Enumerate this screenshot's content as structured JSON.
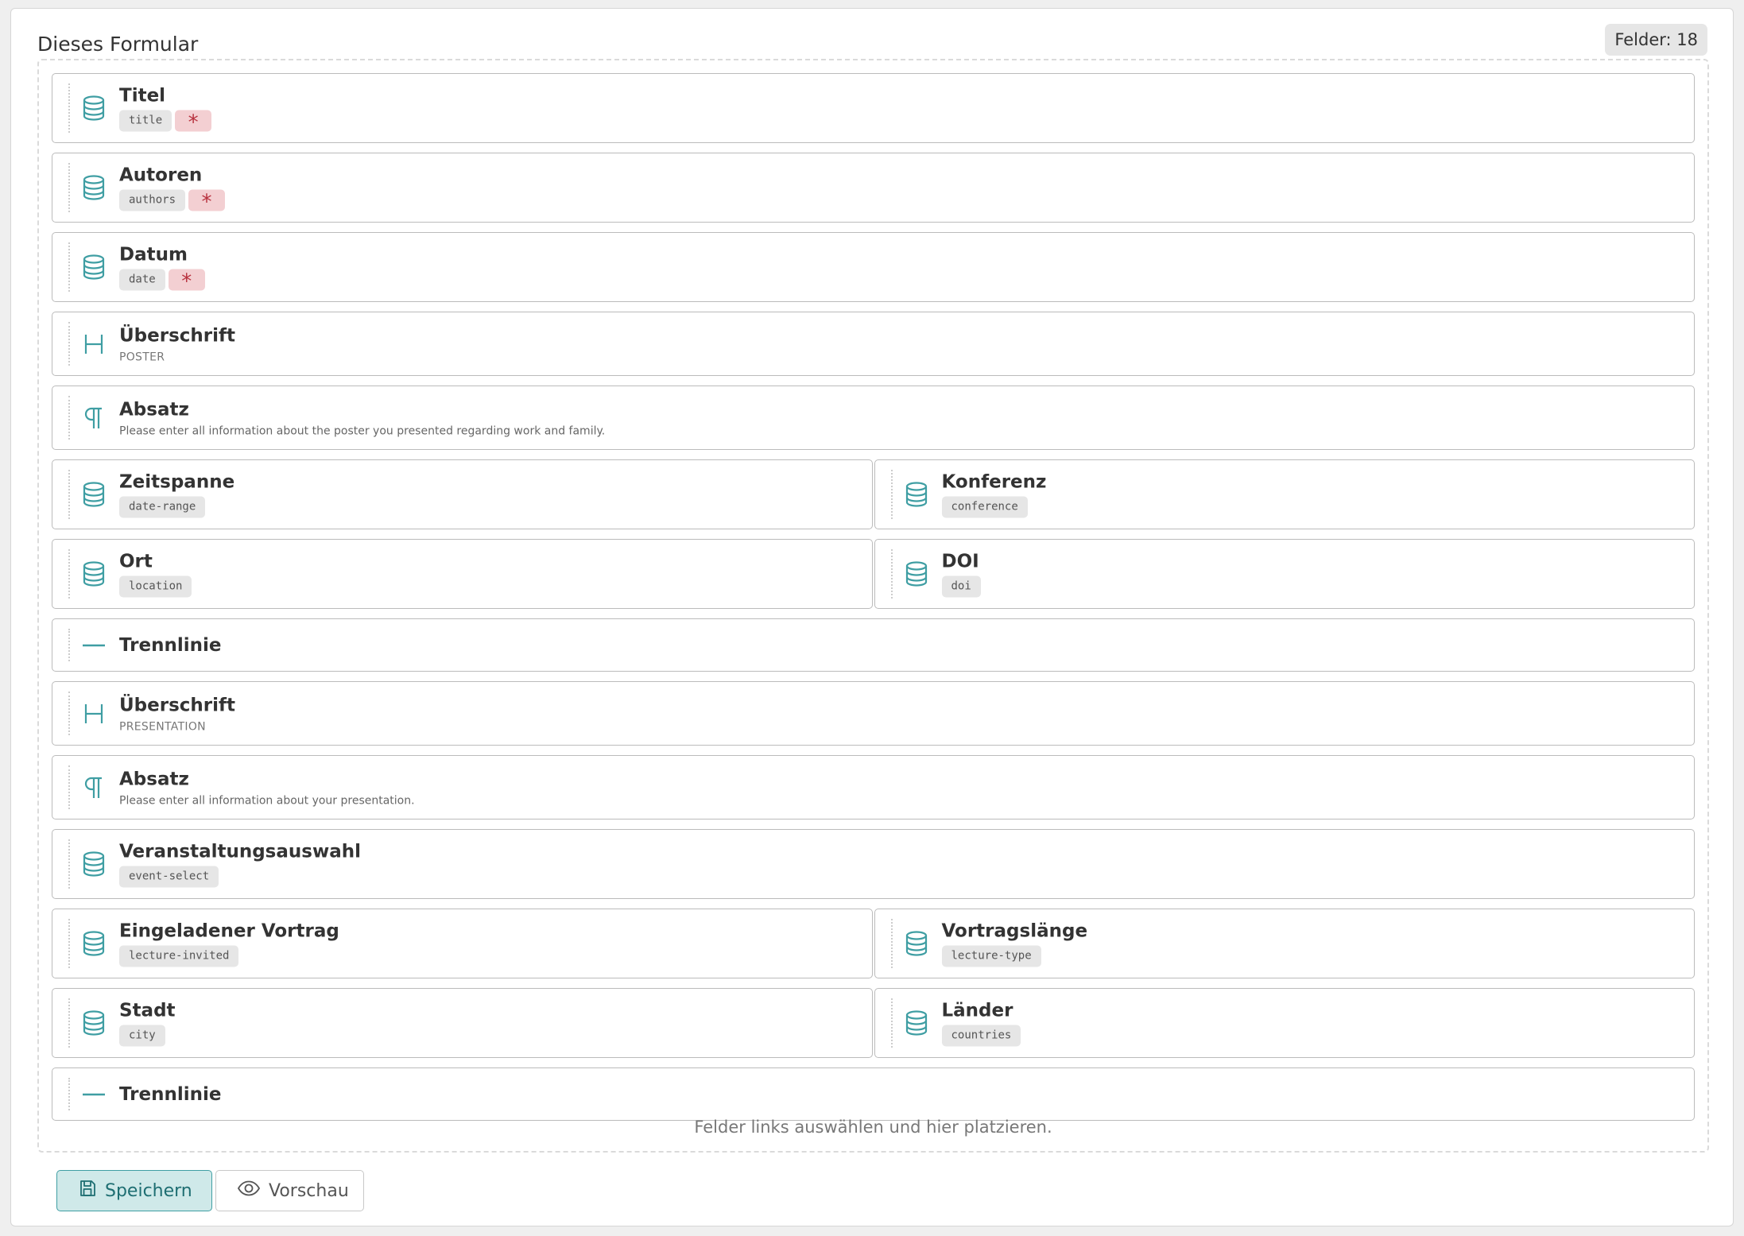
{
  "panel": {
    "title": "Dieses Formular",
    "count_label": "Felder: 18"
  },
  "colors": {
    "accent": "#3f9ea3",
    "required_bg": "#f3cfd2",
    "required_fg": "#b8323f"
  },
  "rows": [
    [
      {
        "type": "data",
        "icon": "database-icon",
        "label": "Titel",
        "key": "title",
        "required": true
      }
    ],
    [
      {
        "type": "data",
        "icon": "database-icon",
        "label": "Autoren",
        "key": "authors",
        "required": true
      }
    ],
    [
      {
        "type": "data",
        "icon": "database-icon",
        "label": "Datum",
        "key": "date",
        "required": true
      }
    ],
    [
      {
        "type": "heading",
        "icon": "heading-icon",
        "label": "Überschrift",
        "sub": "POSTER"
      }
    ],
    [
      {
        "type": "para",
        "icon": "paragraph-icon",
        "label": "Absatz",
        "sub": "Please enter all information about the poster you presented regarding work and family."
      }
    ],
    [
      {
        "type": "data",
        "icon": "database-icon",
        "label": "Zeitspanne",
        "key": "date-range",
        "required": false
      },
      {
        "type": "data",
        "icon": "database-icon",
        "label": "Konferenz",
        "key": "conference",
        "required": false
      }
    ],
    [
      {
        "type": "data",
        "icon": "database-icon",
        "label": "Ort",
        "key": "location",
        "required": false
      },
      {
        "type": "data",
        "icon": "database-icon",
        "label": "DOI",
        "key": "doi",
        "required": false
      }
    ],
    [
      {
        "type": "divider",
        "icon": "divider-icon",
        "label": "Trennlinie"
      }
    ],
    [
      {
        "type": "heading",
        "icon": "heading-icon",
        "label": "Überschrift",
        "sub": "PRESENTATION"
      }
    ],
    [
      {
        "type": "para",
        "icon": "paragraph-icon",
        "label": "Absatz",
        "sub": "Please enter all information about your presentation."
      }
    ],
    [
      {
        "type": "data",
        "icon": "database-icon",
        "label": "Veranstaltungsauswahl",
        "key": "event-select",
        "required": false
      }
    ],
    [
      {
        "type": "data",
        "icon": "database-icon",
        "label": "Eingeladener Vortrag",
        "key": "lecture-invited",
        "required": false
      },
      {
        "type": "data",
        "icon": "database-icon",
        "label": "Vortragslänge",
        "key": "lecture-type",
        "required": false
      }
    ],
    [
      {
        "type": "data",
        "icon": "database-icon",
        "label": "Stadt",
        "key": "city",
        "required": false
      },
      {
        "type": "data",
        "icon": "database-icon",
        "label": "Länder",
        "key": "countries",
        "required": false
      }
    ],
    [
      {
        "type": "divider",
        "icon": "divider-icon",
        "label": "Trennlinie"
      }
    ]
  ],
  "required_symbol": "*",
  "dropzone_hint": "Felder links auswählen und hier platzieren.",
  "buttons": {
    "save": {
      "label": "Speichern",
      "icon": "save-icon"
    },
    "preview": {
      "label": "Vorschau",
      "icon": "eye-icon"
    }
  }
}
